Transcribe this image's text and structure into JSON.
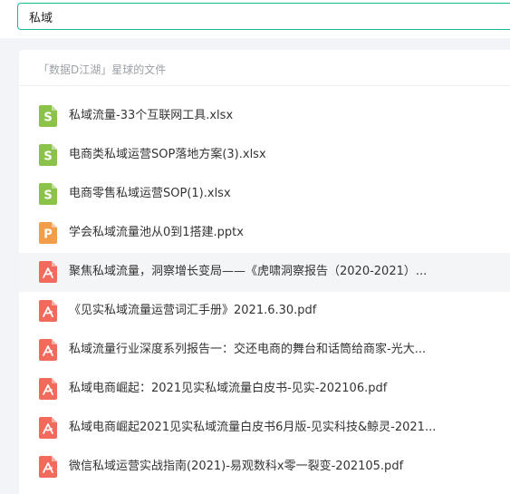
{
  "search": {
    "value": "私域"
  },
  "panel": {
    "title": "「数据D江湖」星球的文件"
  },
  "icon_colors": {
    "xlsx": "#8bc34a",
    "pptx": "#f29d49",
    "pdf": "#f26a5b"
  },
  "files": [
    {
      "name": "私域流量-33个互联网工具.xlsx",
      "type": "xlsx",
      "icon": "spreadsheet-icon",
      "glyph": "S"
    },
    {
      "name": "电商类私域运营SOP落地方案(3).xlsx",
      "type": "xlsx",
      "icon": "spreadsheet-icon",
      "glyph": "S"
    },
    {
      "name": "电商零售私域运营SOP(1).xlsx",
      "type": "xlsx",
      "icon": "spreadsheet-icon",
      "glyph": "S"
    },
    {
      "name": "学会私域流量池从0到1搭建.pptx",
      "type": "pptx",
      "icon": "presentation-icon",
      "glyph": "P"
    },
    {
      "name": "聚焦私域流量，洞察增长变局——《虎啸洞察报告（2020-2021）...",
      "type": "pdf",
      "icon": "pdf-icon",
      "hover": true
    },
    {
      "name": "《见实私域流量运营词汇手册》2021.6.30.pdf",
      "type": "pdf",
      "icon": "pdf-icon"
    },
    {
      "name": "私域流量行业深度系列报告一：交还电商的舞台和话筒给商家-光大...",
      "type": "pdf",
      "icon": "pdf-icon"
    },
    {
      "name": "私域电商崛起：2021见实私域流量白皮书-见实-202106.pdf",
      "type": "pdf",
      "icon": "pdf-icon"
    },
    {
      "name": "私域电商崛起2021见实私域流量白皮书6月版-见实科技&鲸灵-2021...",
      "type": "pdf",
      "icon": "pdf-icon"
    },
    {
      "name": "微信私域运营实战指南(2021)-易观数科x零一裂变-202105.pdf",
      "type": "pdf",
      "icon": "pdf-icon"
    }
  ]
}
